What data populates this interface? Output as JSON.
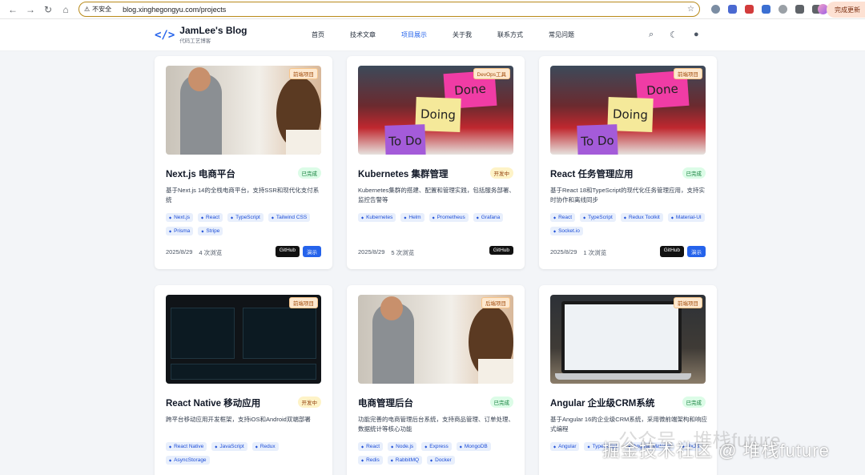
{
  "browser": {
    "security_label": "不安全",
    "url": "blog.xinghegongyu.com/projects",
    "update_button": "完成更新"
  },
  "site": {
    "logo_icon": "</>",
    "title": "JamLee's Blog",
    "subtitle": "代码工艺博客",
    "menu": [
      "首页",
      "技术文章",
      "项目展示",
      "关于我",
      "联系方式",
      "常见问题"
    ]
  },
  "projects": [
    {
      "category": "前端项目",
      "title": "Next.js 电商平台",
      "status": "已完成",
      "desc": "基于Next.js 14的全栈电商平台，支持SSR和现代化支付系统",
      "tags": [
        "Next.js",
        "React",
        "TypeScript",
        "Tailwind CSS",
        "Prisma",
        "Stripe"
      ],
      "date": "2025/8/29",
      "views": "4 次浏览",
      "github": "GitHub",
      "demo": "演示"
    },
    {
      "category": "DevOps工具",
      "title": "Kubernetes 集群管理",
      "status": "开发中",
      "desc": "Kubernetes集群的搭建、配置和管理实践，包括服务部署、监控告警等",
      "tags": [
        "Kubernetes",
        "Helm",
        "Prometheus",
        "Grafana"
      ],
      "date": "2025/8/29",
      "views": "5 次浏览",
      "github": "GitHub"
    },
    {
      "category": "前端项目",
      "title": "React 任务管理应用",
      "status": "已完成",
      "desc": "基于React 18和TypeScript的现代化任务管理应用，支持实时协作和离线同步",
      "tags": [
        "React",
        "TypeScript",
        "Redux Toolkit",
        "Material-UI",
        "Socket.io"
      ],
      "date": "2025/8/29",
      "views": "1 次浏览",
      "github": "GitHub",
      "demo": "演示"
    },
    {
      "category": "前端项目",
      "title": "React Native 移动应用",
      "status": "开发中",
      "desc": "跨平台移动应用开发框架，支持iOS和Android双端部署",
      "tags": [
        "React Native",
        "JavaScript",
        "Redux",
        "AsyncStorage"
      ]
    },
    {
      "category": "后端项目",
      "title": "电商管理后台",
      "status": "已完成",
      "desc": "功能完善的电商管理后台系统，支持商品管理、订单处理、数据统计等核心功能",
      "tags": [
        "React",
        "Node.js",
        "Express",
        "MongoDB",
        "Redis",
        "RabbitMQ",
        "Docker"
      ]
    },
    {
      "category": "前端项目",
      "title": "Angular 企业级CRM系统",
      "status": "已完成",
      "desc": "基于Angular 16的企业级CRM系统，采用微前端架构和响应式编程",
      "tags": [
        "Angular",
        "TypeScript",
        "Angular Material",
        "RxJS"
      ]
    }
  ],
  "note_text": [
    "Done",
    "Doing",
    "To Do"
  ],
  "watermark": "掘金技术社区 @ 堆栈future",
  "watermark_bg": "公众号 · 堆栈future"
}
